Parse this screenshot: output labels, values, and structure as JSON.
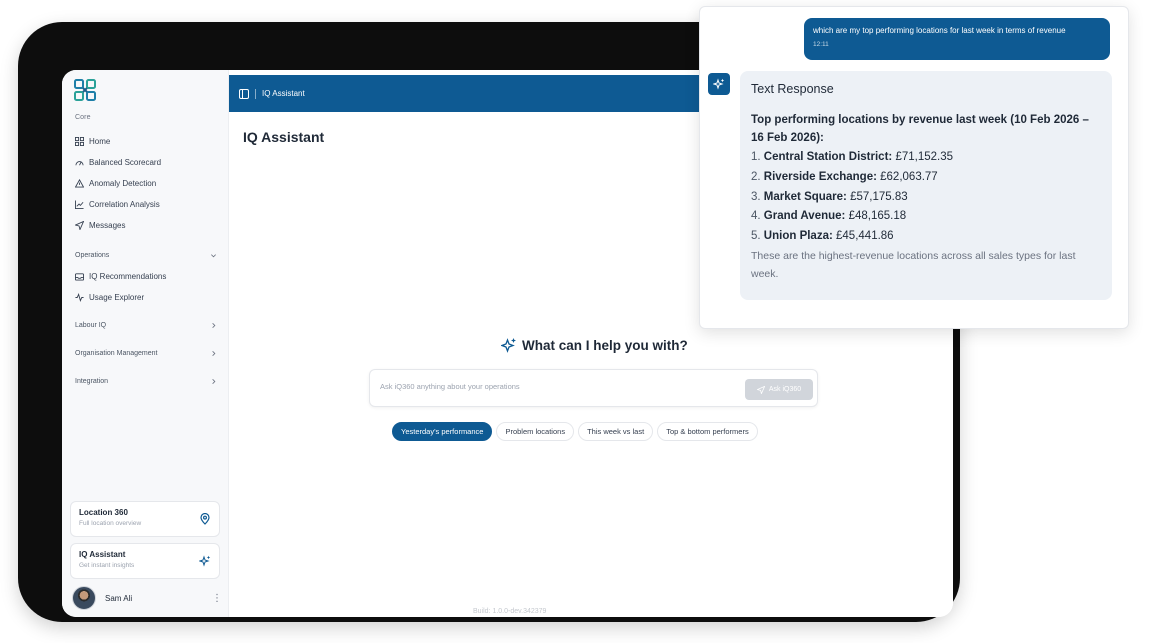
{
  "sidebar": {
    "core_label": "Core",
    "core_items": [
      {
        "label": "Home",
        "icon": "grid-icon"
      },
      {
        "label": "Balanced Scorecard",
        "icon": "gauge-icon"
      },
      {
        "label": "Anomaly Detection",
        "icon": "warning-triangle-icon"
      },
      {
        "label": "Correlation Analysis",
        "icon": "line-chart-icon"
      },
      {
        "label": "Messages",
        "icon": "send-icon"
      }
    ],
    "operations_label": "Operations",
    "operations_items": [
      {
        "label": "IQ Recommendations",
        "icon": "inbox-icon"
      },
      {
        "label": "Usage Explorer",
        "icon": "activity-icon"
      }
    ],
    "groups": [
      "Labour IQ",
      "Organisation Management",
      "Integration"
    ],
    "location_card": {
      "title": "Location 360",
      "subtitle": "Full location overview"
    },
    "assistant_card": {
      "title": "IQ Assistant",
      "subtitle": "Get instant insights"
    },
    "user_name": "Sam Ali"
  },
  "header": {
    "breadcrumb": "IQ Assistant"
  },
  "main": {
    "title": "IQ Assistant",
    "prompt_heading": "What can I help you with?",
    "input_placeholder": "Ask iQ360 anything about your operations",
    "ask_button": "Ask iQ360",
    "chips": [
      "Yesterday's performance",
      "Problem locations",
      "This week vs last",
      "Top & bottom performers"
    ],
    "build": "Build: 1.0.0-dev.342379"
  },
  "chat": {
    "user_message": "which are my top performing locations for last week in terms of revenue",
    "user_time": "12:11",
    "response_title": "Text Response",
    "response_lead": "Top performing locations by revenue last week (10 Feb 2026 – 16 Feb 2026):",
    "locations": [
      {
        "num": "1.",
        "name": "Central Station District:",
        "value": "£71,152.35"
      },
      {
        "num": "2.",
        "name": "Riverside Exchange:",
        "value": "£62,063.77"
      },
      {
        "num": "3.",
        "name": "Market Square:",
        "value": "£57,175.83"
      },
      {
        "num": "4.",
        "name": "Grand Avenue:",
        "value": "£48,165.18"
      },
      {
        "num": "5.",
        "name": "Union Plaza:",
        "value": "£45,441.86"
      }
    ],
    "response_footer": "These are the highest-revenue locations across all sales types for last week."
  },
  "colors": {
    "brand": "#0e5a93",
    "sidebar_bg": "#f7f8fa",
    "bubble_bg": "#edf1f6"
  }
}
